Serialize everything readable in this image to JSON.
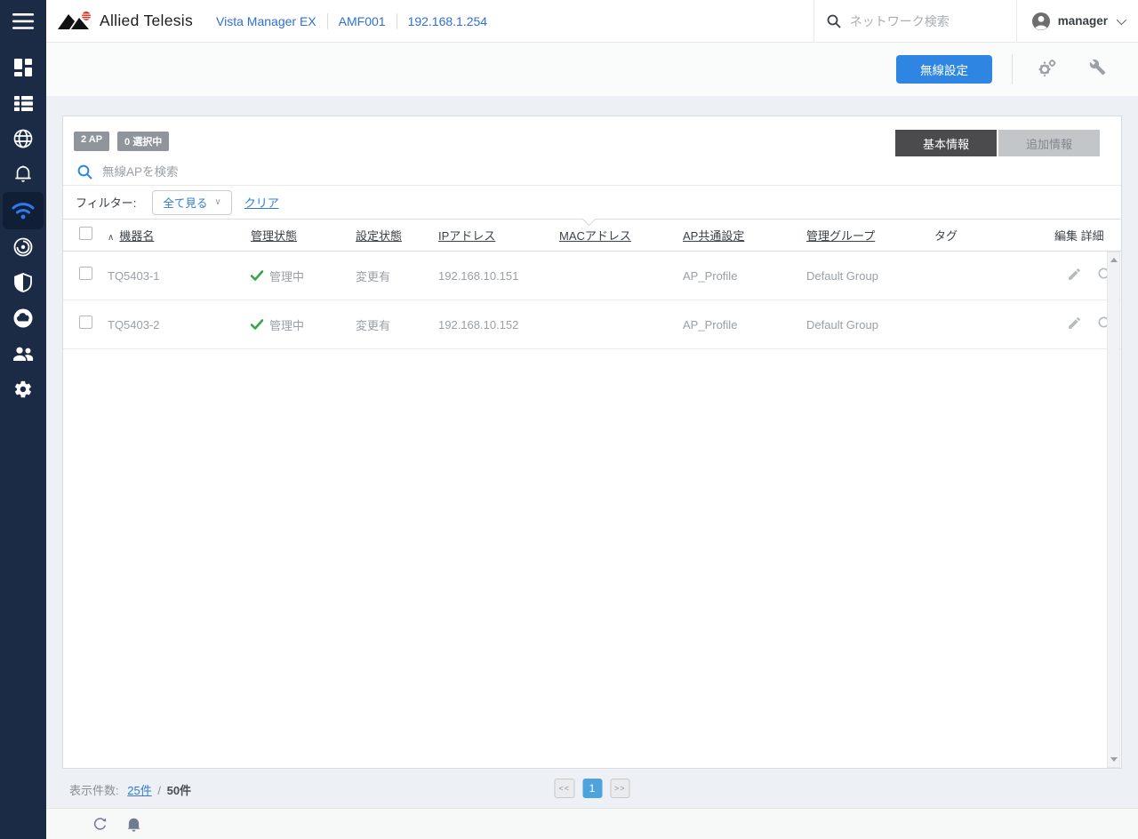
{
  "colors": {
    "sidebar": "#1b2a45",
    "accent_blue": "#2e86e2",
    "link_blue": "#2e7cd6",
    "status_green": "#36a546",
    "active_tab": "#4b4b4d",
    "page_bg": "#edf0f4"
  },
  "sidebar": {
    "icons": [
      "menu",
      "dashboard",
      "device-list",
      "network-map",
      "event-log",
      "wireless",
      "sdwan",
      "security",
      "cloud",
      "users",
      "settings"
    ],
    "active_icon": "wireless"
  },
  "header": {
    "brand": "Allied Telesis",
    "product": "Vista Manager EX",
    "network_name": "AMF001",
    "controller_ip": "192.168.1.254",
    "search_placeholder": "ネットワーク検索",
    "user_name": "manager"
  },
  "toolbar": {
    "wireless_settings_label": "無線設定"
  },
  "panel": {
    "badge_ap_count": "2 AP",
    "badge_selected": "0 選択中",
    "tab_basic": "基本情報",
    "tab_additional": "追加情報",
    "search_placeholder": "無線APを検索",
    "filter_label": "フィルター:",
    "filter_dropdown_value": "全て見る",
    "filter_dropdown_caret": "∨",
    "filter_clear": "クリア"
  },
  "table": {
    "sort_indicator": "∧",
    "columns": [
      {
        "label": "機器名",
        "sortable": true
      },
      {
        "label": "管理状態",
        "sortable": true
      },
      {
        "label": "設定状態",
        "sortable": true
      },
      {
        "label": "IPアドレス",
        "sortable": true
      },
      {
        "label": "MACアドレス",
        "sortable": true
      },
      {
        "label": "AP共通設定",
        "sortable": true
      },
      {
        "label": "管理グループ",
        "sortable": true
      },
      {
        "label": "タグ",
        "sortable": false
      },
      {
        "label": "編集 詳細",
        "sortable": false
      }
    ],
    "rows": [
      {
        "name": "TQ5403-1",
        "mgmt_status": "管理中",
        "config_status": "変更有",
        "ip": "192.168.10.151",
        "mac_redacted": true,
        "ap_profile": "AP_Profile",
        "mgmt_group": "Default Group"
      },
      {
        "name": "TQ5403-2",
        "mgmt_status": "管理中",
        "config_status": "変更有",
        "ip": "192.168.10.152",
        "mac_redacted": true,
        "ap_profile": "AP_Profile",
        "mgmt_group": "Default Group"
      }
    ]
  },
  "footer": {
    "count_label": "表示件数:",
    "page_size": "25件",
    "separator": "/",
    "total": "50件",
    "prev": "<<",
    "current_page": "1",
    "next": ">>"
  }
}
